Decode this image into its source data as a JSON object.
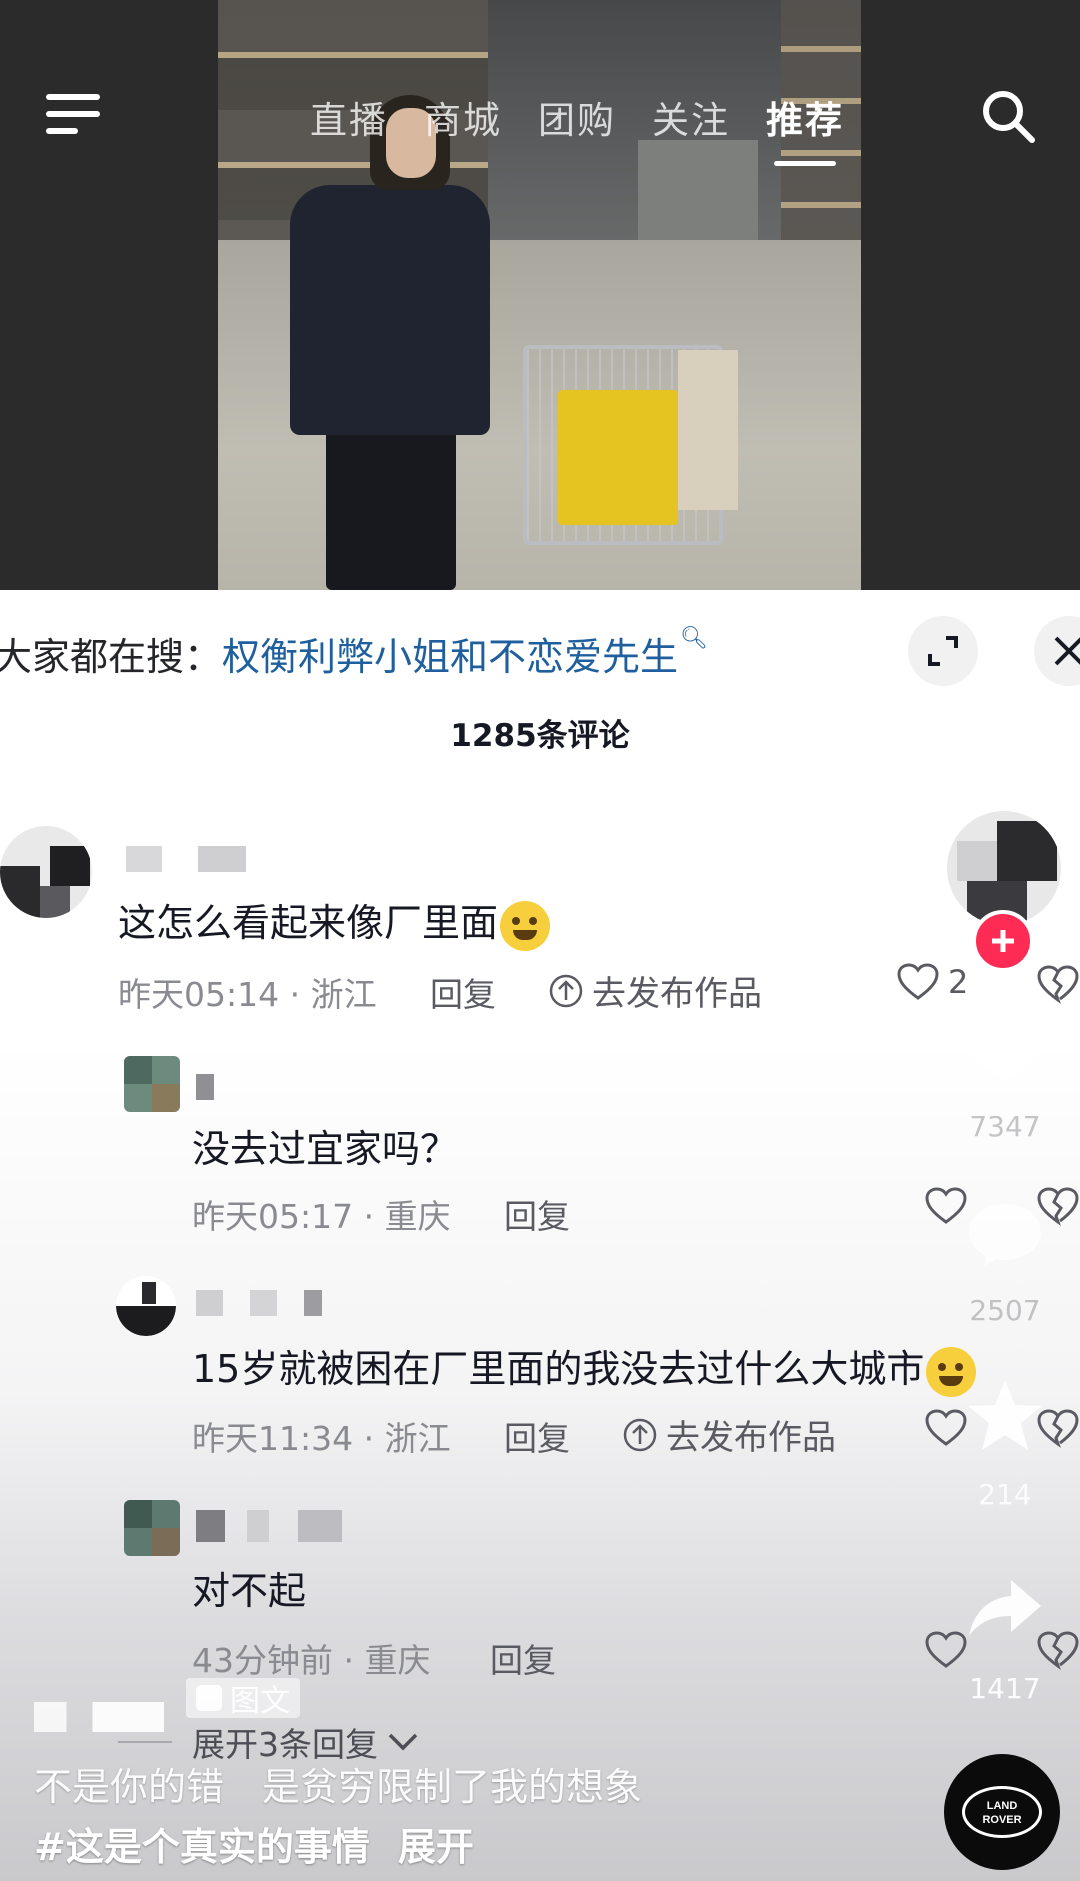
{
  "top_nav": {
    "tabs": [
      {
        "label": "直播",
        "active": false
      },
      {
        "label": "商城",
        "active": false
      },
      {
        "label": "团购",
        "active": false
      },
      {
        "label": "关注",
        "active": false
      },
      {
        "label": "推荐",
        "active": true
      }
    ],
    "menu_icon": "menu-icon",
    "search_icon": "search-icon"
  },
  "search_suggestion": {
    "prefix": "大家都在搜：",
    "term": "权衡利弊小姐和不恋爱先生"
  },
  "comments_header": {
    "count_label": "1285条评论"
  },
  "comments": [
    {
      "text": "这怎么看起来像厂里面",
      "emoji": "smiling-face",
      "time_location": "昨天05:14 · 浙江",
      "reply_label": "回复",
      "publish_label": "去发布作品",
      "likes": "2"
    },
    {
      "text": "没去过宜家吗？",
      "time_location": "昨天05:17 · 重庆",
      "reply_label": "回复"
    },
    {
      "text": "15岁就被困在厂里面的我没去过什么大城市",
      "emoji": "grinning-sweat-face",
      "time_location": "昨天11:34 · 浙江",
      "reply_label": "回复",
      "publish_label": "去发布作品"
    },
    {
      "text": "对不起",
      "time_location": "43分钟前 · 重庆",
      "reply_label": "回复"
    }
  ],
  "expand_replies_label": "展开3条回复",
  "side_actions": {
    "like_count": "7347",
    "comment_count": "2507",
    "favorite_count": "214",
    "share_count": "1417"
  },
  "tuwen_label": "图文",
  "caption": "不是你的错　是贫穷限制了我的想象",
  "hashtag": "#这是个真实的事情",
  "hashtag_expand": "展开",
  "brand": {
    "line1": "LAND",
    "line2": "ROVER"
  },
  "colors": {
    "accent_red": "#fe2c55",
    "link_blue": "#1f5f9e",
    "meta_gray": "#8a8b91"
  }
}
